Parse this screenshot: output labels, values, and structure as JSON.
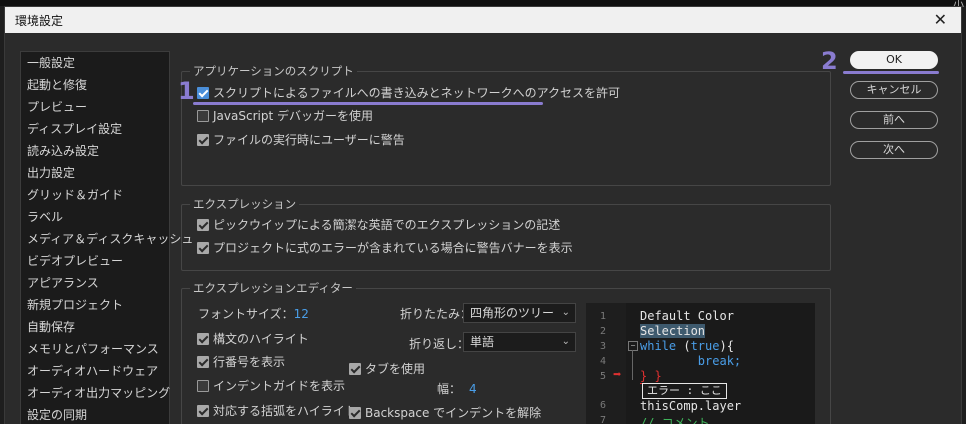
{
  "window": {
    "title": "環境設定",
    "top_right_text": "小"
  },
  "sidebar": {
    "items": [
      {
        "label": "一般設定"
      },
      {
        "label": "起動と修復"
      },
      {
        "label": "プレビュー"
      },
      {
        "label": "ディスプレイ設定"
      },
      {
        "label": "読み込み設定"
      },
      {
        "label": "出力設定"
      },
      {
        "label": "グリッド＆ガイド"
      },
      {
        "label": "ラベル"
      },
      {
        "label": "メディア＆ディスクキャッシュ"
      },
      {
        "label": "ビデオプレビュー"
      },
      {
        "label": "アピアランス"
      },
      {
        "label": "新規プロジェクト"
      },
      {
        "label": "自動保存"
      },
      {
        "label": "メモリとパフォーマンス"
      },
      {
        "label": "オーディオハードウェア"
      },
      {
        "label": "オーディオ出力マッピング"
      },
      {
        "label": "設定の同期"
      }
    ]
  },
  "app_scripts": {
    "legend": "アプリケーションのスクリプト",
    "opt1": {
      "label": "スクリプトによるファイルへの書き込みとネットワークへのアクセスを許可",
      "checked": true
    },
    "opt2": {
      "label": "JavaScript デバッガーを使用",
      "checked": false
    },
    "opt3": {
      "label": "ファイルの実行時にユーザーに警告",
      "checked": true
    }
  },
  "expressions": {
    "legend": "エクスプレッション",
    "opt1": {
      "label": "ピックウイップによる簡潔な英語でのエクスプレッションの記述",
      "checked": true
    },
    "opt2": {
      "label": "プロジェクトに式のエラーが含まれている場合に警告バナーを表示",
      "checked": true
    }
  },
  "editor": {
    "legend": "エクスプレッションエディター",
    "font_size_label": "フォントサイズ：",
    "font_size_value": "12",
    "fold_label": "折りたたみ：",
    "fold_value": "四角形のツリー",
    "wrap_label": "折り返し：",
    "wrap_value": "単語",
    "syntax_highlight": {
      "label": "構文のハイライト",
      "checked": true
    },
    "line_numbers": {
      "label": "行番号を表示",
      "checked": true
    },
    "indent_guides": {
      "label": "インデントガイドを表示",
      "checked": false
    },
    "bracket_highlight": {
      "label": "対応する括弧をハイライト",
      "checked": true
    },
    "use_tabs": {
      "label": "タブを使用",
      "checked": true
    },
    "width_label": "幅：",
    "width_value": "4",
    "backspace": {
      "label": "Backspace でインデントを解除",
      "checked": true
    }
  },
  "code_preview": {
    "line_numbers": [
      "1",
      "2",
      "3",
      "4",
      "5",
      "6",
      "7"
    ],
    "lines": [
      "Default Color",
      "Selection",
      "while (true){",
      "        break;",
      "} }",
      "thisComp.layer",
      "// コメント"
    ],
    "while_kw": "while",
    "true_kw": "true",
    "error_tooltip": "エラー : ここ"
  },
  "buttons": {
    "ok": "OK",
    "cancel": "キャンセル",
    "prev": "前へ",
    "next": "次へ"
  },
  "annotations": {
    "one": "1",
    "two": "2"
  },
  "colors": {
    "accent": "#8a7cd0",
    "keyword": "#4a9ee8",
    "error": "#e03030"
  }
}
